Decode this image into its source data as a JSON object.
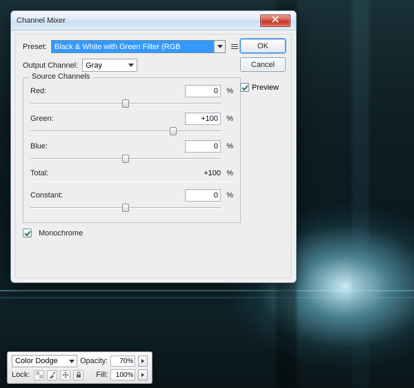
{
  "dialog": {
    "title": "Channel Mixer",
    "preset_label": "Preset:",
    "preset_value": "Black & White with Green Filter (RGB",
    "output_label": "Output Channel:",
    "output_value": "Gray",
    "group_title": "Source Channels",
    "red_label": "Red:",
    "red_value": "0",
    "green_label": "Green:",
    "green_value": "+100",
    "blue_label": "Blue:",
    "blue_value": "0",
    "total_label": "Total:",
    "total_value": "+100",
    "constant_label": "Constant:",
    "constant_value": "0",
    "percent": "%",
    "monochrome_label": "Monochrome",
    "buttons": {
      "ok": "OK",
      "cancel": "Cancel"
    },
    "preview_label": "Preview"
  },
  "strip": {
    "blend_mode": "Color Dodge",
    "opacity_label": "Opacity:",
    "opacity_value": "70%",
    "lock_label": "Lock:",
    "fill_label": "Fill:",
    "fill_value": "100%"
  }
}
